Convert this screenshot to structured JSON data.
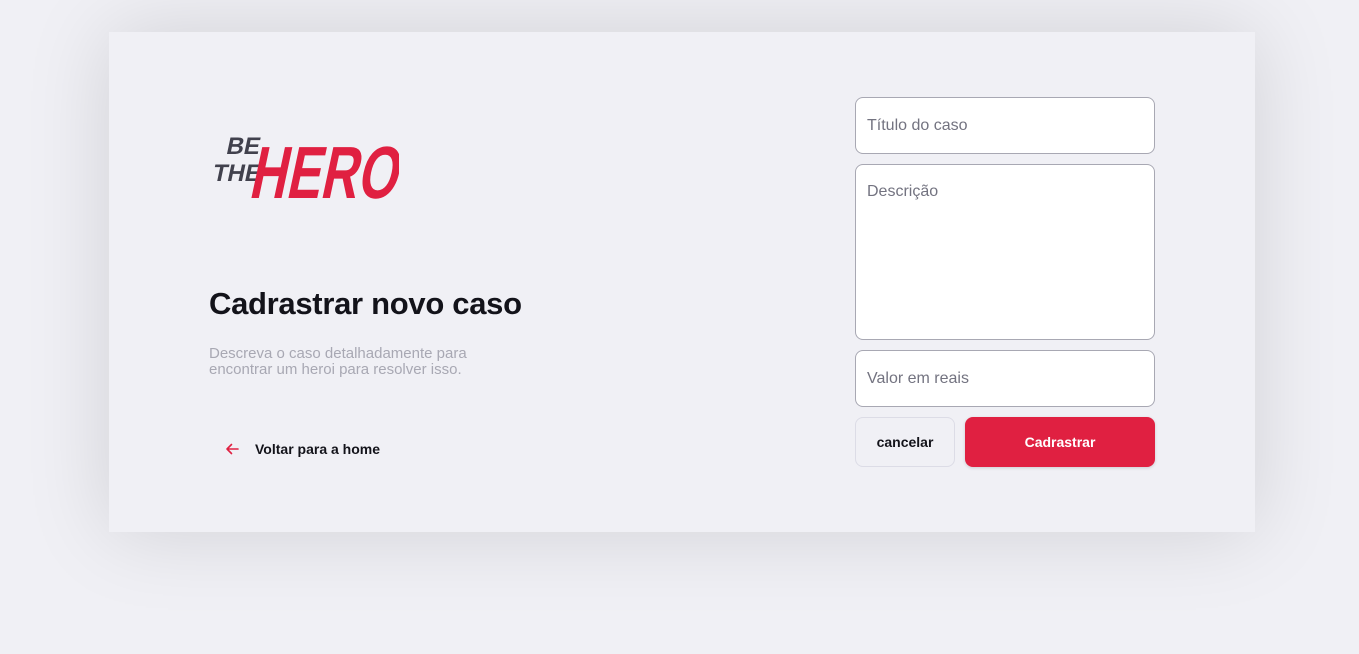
{
  "logo": {
    "text_top": "BE",
    "text_middle": "THE",
    "text_main": "HERO",
    "color_dark": "#41414d",
    "color_brand": "#e02041"
  },
  "page": {
    "title": "Cadrastrar novo caso",
    "description": "Descreva o caso detalhadamente para encontrar um heroi para resolver isso.",
    "back_link": "Voltar para a home"
  },
  "form": {
    "title_placeholder": "Título do caso",
    "description_placeholder": "Descrição",
    "value_placeholder": "Valor em reais",
    "cancel_label": "cancelar",
    "submit_label": "Cadrastrar"
  },
  "icons": {
    "back": "arrow-left-icon"
  }
}
